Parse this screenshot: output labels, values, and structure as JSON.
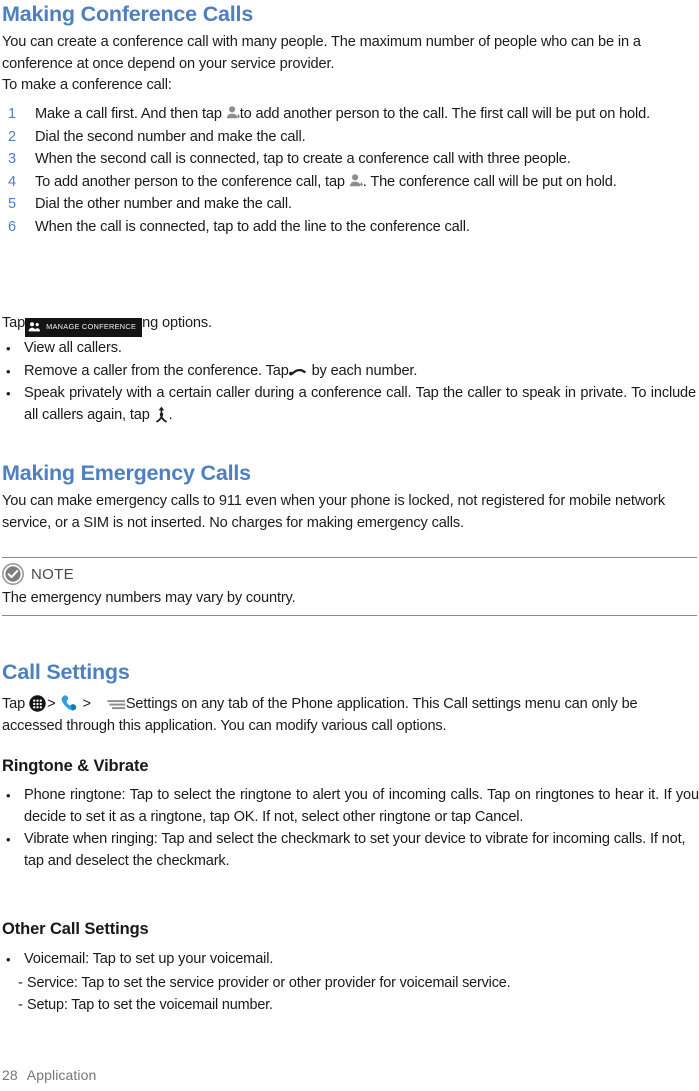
{
  "document": {
    "footer": {
      "page_number": "28",
      "chapter": "Application"
    }
  },
  "conference": {
    "heading": "Making Conference Calls",
    "intro": "You can create a conference call with many people. The maximum number of people who can be in a conference at once depend on your service  provider.",
    "intro_line2": "To make a conference call:",
    "steps": [
      {
        "num": "1",
        "text_before": "Make a call first. And then tap ",
        "icon": "add-person-icon",
        "text_after": "to add another person to the call. The first call will be put on  hold."
      },
      {
        "num": "2",
        "text_before": "Dial the second number and make the  call.",
        "icon": "",
        "text_after": ""
      },
      {
        "num": "3",
        "text_before": "When the second call is connected, tap to create a conference call with three people.",
        "icon": "",
        "text_after": ""
      },
      {
        "num": "4",
        "text_before": "To add another person to the conference call, tap ",
        "icon": "add-person-icon",
        "text_after": ". The conference call will be put on  hold."
      },
      {
        "num": "5",
        "text_before": "Dial the other number and make the  call.",
        "icon": "",
        "text_after": ""
      },
      {
        "num": "6",
        "text_before": "When the call is connected, tap to add the line to the conference call.",
        "icon": "",
        "text_after": ""
      }
    ],
    "manage_lead": "Tap",
    "manage_button_label": "MANAGE CONFERENCE",
    "manage_trail": "ng  options.",
    "options": [
      {
        "text_before": "View all callers.",
        "icon": "",
        "text_after": ""
      },
      {
        "text_before": "Remove a caller from the  conference. Tap",
        "icon": "end-call-icon",
        "text_after": " by each  number."
      },
      {
        "text_before": "Speak privately with a certain caller during a conference call. Tap the caller to speak in private. To include all callers again, tap ",
        "icon": "merge-call-icon",
        "text_after": "."
      }
    ]
  },
  "emergency": {
    "heading": "Making Emergency Calls",
    "body": "You can make emergency calls to 911 even when your phone is locked, not registered for mobile network service, or a SIM is not inserted. No charges for making emergency calls."
  },
  "note": {
    "icon": "note-check-icon",
    "label": "NOTE",
    "body": "The emergency numbers may vary by country."
  },
  "call_settings": {
    "heading": "Call Settings",
    "path_lead": "Tap",
    "icon_apps": "apps-grid-icon",
    "sep1": ">",
    "icon_phone": "phone-handset-icon",
    "sep2": ">",
    "icon_menu": "menu-lines-icon",
    "path_trail": "Settings on any tab of the Phone application. This Call settings menu can only be accessed through this application. You can modify various call   options.",
    "ringtone": {
      "heading": "Ringtone & Vibrate",
      "items": [
        "Phone ringtone: Tap to select the ringtone to alert you of incoming calls. Tap on ringtones to hear it. If you decide to set it as a ringtone, tap OK. If not, select other ringtone or tap Cancel.",
        "Vibrate when ringing: Tap and select the checkmark to set your device to vibrate for incoming calls. If not, tap and deselect the  checkmark."
      ]
    },
    "other": {
      "heading": "Other Call Settings",
      "items": [
        "Voicemail: Tap to set up your  voicemail."
      ],
      "sub_items": [
        "Service: Tap to set the service provider or other provider for voicemail   service.",
        "Setup: Tap to set the voicemail  number."
      ]
    }
  },
  "glyphs": {
    "bullet": "•",
    "dash": "-"
  },
  "colors": {
    "heading_blue": "#4e7fc1",
    "text_black": "#1c1c1c",
    "note_gray": "#8a8a8a",
    "footer_gray": "#767676",
    "phone_blue": "#2f9fe0"
  }
}
